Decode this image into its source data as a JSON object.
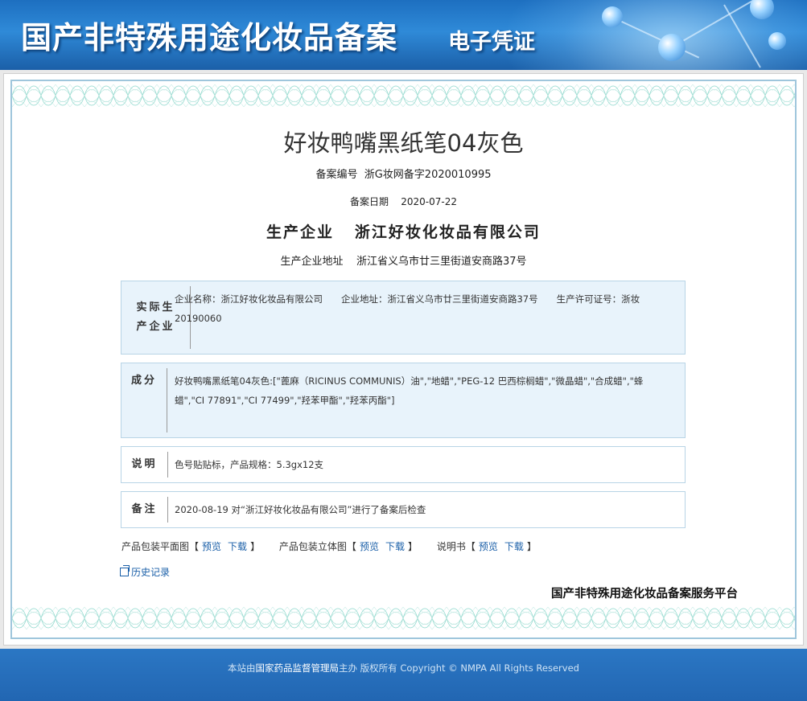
{
  "header": {
    "title": "国产非特殊用途化妆品备案",
    "subtitle": "电子凭证"
  },
  "record": {
    "product_name": "好妆鸭嘴黑纸笔04灰色",
    "filing_no_label": "备案编号",
    "filing_no": "浙G妆网备字2020010995",
    "filing_date_label": "备案日期",
    "filing_date": "2020-07-22",
    "producer_label": "生产企业",
    "producer": "浙江好妆化妆品有限公司",
    "producer_address_label": "生产企业地址",
    "producer_address": "浙江省义乌市廿三里街道安商路37号"
  },
  "sections": {
    "actual_producer": {
      "label": "实际生产企业",
      "content": "企业名称：浙江好妆化妆品有限公司　　企业地址：浙江省义乌市廿三里街道安商路37号　　生产许可证号：浙妆20190060"
    },
    "ingredients": {
      "label": "成分",
      "content": "好妆鸭嘴黑纸笔04灰色:[\"蓖麻（RICINUS COMMUNIS）油\",\"地蜡\",\"PEG-12 巴西棕榈蜡\",\"微晶蜡\",\"合成蜡\",\"蜂蜡\",\"CI 77891\",\"CI 77499\",\"羟苯甲酯\",\"羟苯丙酯\"]"
    },
    "notes": {
      "label": "说明",
      "content": "色号贴贴标，产品规格：5.3gx12支"
    },
    "remarks": {
      "label": "备注",
      "content": "2020-08-19 对“浙江好妆化妆品有限公司”进行了备案后检查"
    }
  },
  "downloads": [
    {
      "label": "产品包装平面图",
      "open": "【",
      "preview": "预览",
      "download": "下载",
      "close": "】"
    },
    {
      "label": "产品包装立体图",
      "open": "【",
      "preview": "预览",
      "download": "下载",
      "close": "】"
    },
    {
      "label": "说明书",
      "open": "【",
      "preview": "预览",
      "download": "下载",
      "close": "】"
    }
  ],
  "history_link": "历史记录",
  "platform_name": "国产非特殊用途化妆品备案服务平台",
  "footer": {
    "prefix": "本站由",
    "org": "国家药品监督管理局",
    "suffix": "主办 版权所有 Copyright © NMPA All Rights Reserved"
  },
  "colors": {
    "banner": "#1d6fc0",
    "frame_border": "#9fc6dc",
    "box_fill": "#e8f3fb",
    "link": "#1a5fa8",
    "footer": "#2266b2"
  }
}
